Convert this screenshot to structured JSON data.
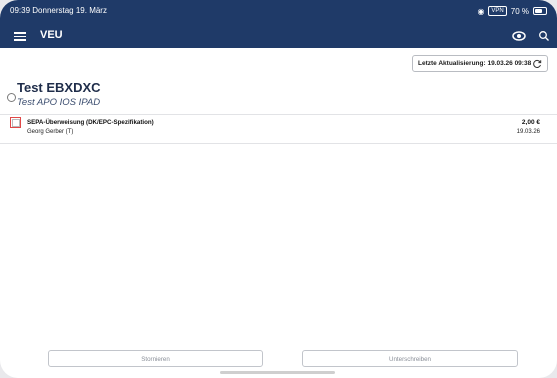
{
  "status_bar": {
    "time": "09:39",
    "date": "Donnerstag 19. März",
    "vpn": "VPN",
    "battery": "70 %"
  },
  "header": {
    "title": "VEU",
    "icons": [
      "menu-icon",
      "eye-icon",
      "search-icon"
    ]
  },
  "toolbar": {
    "update_label": "Letzte Aktualisierung: 19.03.26 09:38"
  },
  "account": {
    "name": "Test EBXDXC",
    "subtitle": "Test APO IOS IPAD"
  },
  "transactions": [
    {
      "title": "SEPA-Überweisung (DK/EPC-Spezifikation)",
      "party": "Georg Gerber (T)",
      "amount": "2,00 €",
      "date": "19.03.26"
    }
  ],
  "actions": {
    "cancel_label": "Stornieren",
    "sign_label": "Unterschreiben"
  },
  "colors": {
    "header_bg": "#1f3a68",
    "selection_border": "#e04848"
  }
}
